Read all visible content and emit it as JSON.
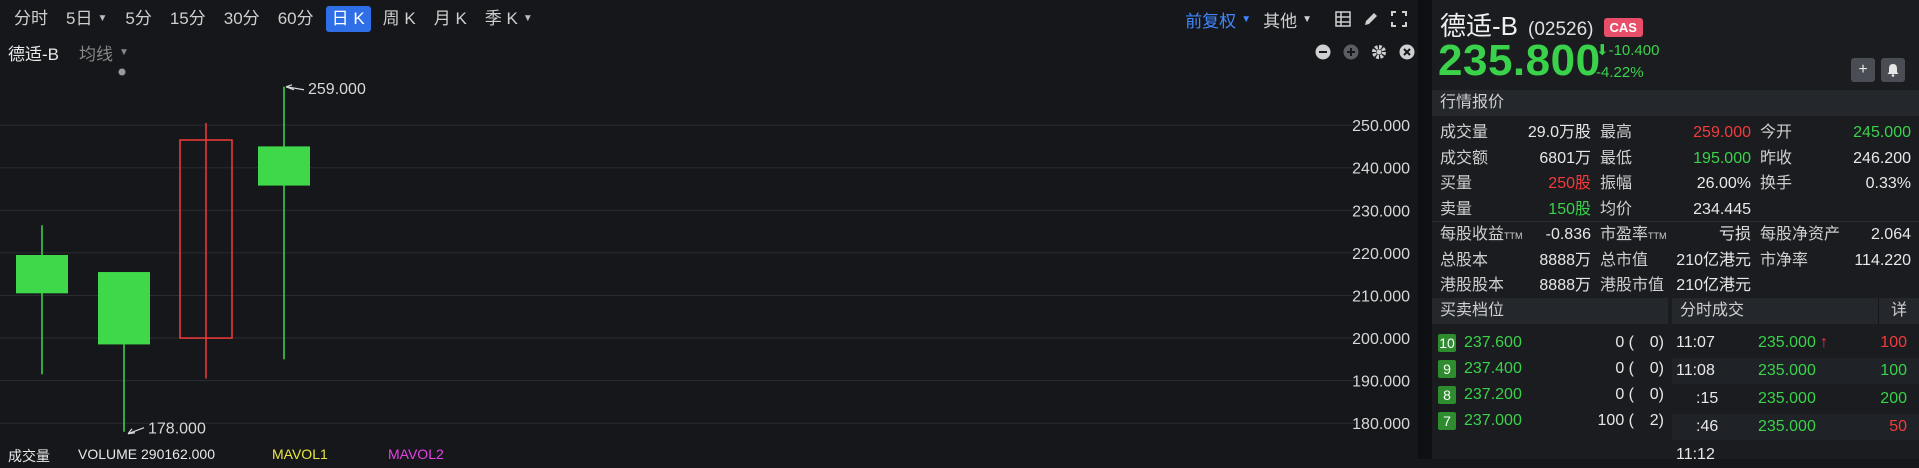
{
  "toolbar": {
    "periods": [
      "分时",
      "5日",
      "5分",
      "15分",
      "30分",
      "60分",
      "日 K",
      "周 K",
      "月 K",
      "季 K"
    ],
    "active": "日 K",
    "restore": "前复权",
    "other": "其他"
  },
  "subbar": {
    "stock_name": "德适-B",
    "ma_label": "均线"
  },
  "chart_data": {
    "type": "candlestick",
    "y_ticks": [
      "250.000",
      "240.000",
      "230.000",
      "220.000",
      "210.000",
      "200.000",
      "190.000",
      "180.000"
    ],
    "ylim": [
      177,
      262
    ],
    "candles": [
      {
        "open": 210.5,
        "close": 219.5,
        "high": 226.5,
        "low": 191.5,
        "color": "green"
      },
      {
        "open": 215.5,
        "close": 198.5,
        "high": 198.5,
        "low": 178.0,
        "color": "green"
      },
      {
        "open": 200.0,
        "close": 246.5,
        "high": 250.5,
        "low": 190.5,
        "color": "red"
      },
      {
        "open": 245.0,
        "close": 235.8,
        "high": 259.0,
        "low": 195.0,
        "color": "green"
      }
    ],
    "annotations": {
      "high": "259.000",
      "low": "178.000"
    }
  },
  "volume_bar": {
    "label": "成交量",
    "volume": "VOLUME 290162.000",
    "ma1": "MAVOL1",
    "ma2": "MAVOL2"
  },
  "stock": {
    "name": "德适-B",
    "code": "(02526)",
    "badge": "CAS",
    "price": "235.800",
    "change": "-10.400",
    "change_pct": "-4.22%",
    "arrow": "⬇"
  },
  "quote": {
    "header": "行情报价",
    "rows": [
      [
        {
          "l": "成交量",
          "v": "29.0万股",
          "c": "w"
        },
        {
          "l": "最高",
          "v": "259.000",
          "c": "r"
        },
        {
          "l": "今开",
          "v": "245.000",
          "c": "g"
        }
      ],
      [
        {
          "l": "成交额",
          "v": "6801万",
          "c": "w"
        },
        {
          "l": "最低",
          "v": "195.000",
          "c": "g"
        },
        {
          "l": "昨收",
          "v": "246.200",
          "c": "w"
        }
      ],
      [
        {
          "l": "买量",
          "v": "250股",
          "c": "r"
        },
        {
          "l": "振幅",
          "v": "26.00%",
          "c": "w"
        },
        {
          "l": "换手",
          "v": "0.33%",
          "c": "w"
        }
      ],
      [
        {
          "l": "卖量",
          "v": "150股",
          "c": "g"
        },
        {
          "l": "均价",
          "v": "234.445",
          "c": "w"
        },
        {
          "l": "",
          "v": "",
          "c": "w"
        }
      ]
    ],
    "rows2": [
      [
        {
          "l": "每股收益",
          "sub": "TTM",
          "v": "-0.836"
        },
        {
          "l": "市盈率",
          "sub": "TTM",
          "v": "亏损"
        },
        {
          "l": "每股净资产",
          "sub": "",
          "v": "2.064"
        }
      ],
      [
        {
          "l": "总股本",
          "sub": "",
          "v": "8888万"
        },
        {
          "l": "总市值",
          "sub": "",
          "v": "210亿港元"
        },
        {
          "l": "市净率",
          "sub": "",
          "v": "114.220"
        }
      ],
      [
        {
          "l": "港股股本",
          "sub": "",
          "v": "8888万"
        },
        {
          "l": "港股市值",
          "sub": "",
          "v": "210亿港元"
        },
        {
          "l": "",
          "sub": "",
          "v": ""
        }
      ]
    ]
  },
  "orderbook": {
    "header": "买卖档位",
    "rows": [
      {
        "lvl": "10",
        "price": "237.600",
        "qty": "0 (",
        "cnt": "0)"
      },
      {
        "lvl": "9",
        "price": "237.400",
        "qty": "0 (",
        "cnt": "0)"
      },
      {
        "lvl": "8",
        "price": "237.200",
        "qty": "0 (",
        "cnt": "0)"
      },
      {
        "lvl": "7",
        "price": "237.000",
        "qty": "100 (",
        "cnt": "2)"
      }
    ]
  },
  "ticks": {
    "header": "分时成交",
    "detail": "详",
    "rows": [
      {
        "time": "11:07",
        "price": "235.000",
        "arrow": "↑",
        "vol": "100",
        "vc": "r"
      },
      {
        "time": "11:08",
        "price": "235.000",
        "arrow": "",
        "vol": "100",
        "vc": "g"
      },
      {
        "time": ":15",
        "price": "235.000",
        "arrow": "",
        "vol": "200",
        "vc": "g"
      },
      {
        "time": ":46",
        "price": "235.000",
        "arrow": "",
        "vol": "50",
        "vc": "r"
      },
      {
        "time": "11:12",
        "price": "",
        "arrow": "",
        "vol": "",
        "vc": "w"
      }
    ]
  }
}
